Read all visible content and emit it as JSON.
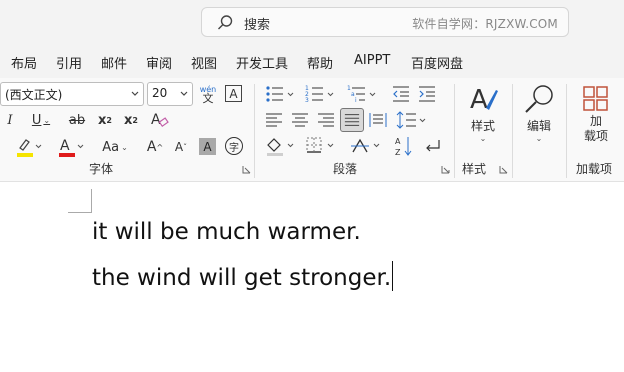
{
  "search": {
    "placeholder": "搜索",
    "watermark": "软件自学网：RJZXW.COM"
  },
  "menu": {
    "items": [
      "布局",
      "引用",
      "邮件",
      "审阅",
      "视图",
      "开发工具",
      "帮助",
      "AIPPT",
      "百度网盘"
    ]
  },
  "ribbon": {
    "font_name": "(西文正文)",
    "font_size": "20",
    "phonetic_top": "wén",
    "phonetic_bottom": "文",
    "char_border": "A",
    "italic": "I",
    "underline": "U",
    "strikethrough": "ab",
    "subscript_base": "x",
    "subscript_sub": "2",
    "superscript_base": "x",
    "superscript_sup": "2",
    "change_case": "Aa",
    "grow_font": "A",
    "shrink_font": "A",
    "shading": "A",
    "enclose_char": "字",
    "group_font": "字体",
    "group_paragraph": "段落",
    "group_styles": "样式",
    "styles_button": "样式",
    "edit_button": "编辑",
    "addin_button_line1": "加",
    "addin_button_line2": "载项",
    "group_addins": "加载项"
  },
  "colors": {
    "highlight": "#f5e400",
    "font_color": "#e01b1b",
    "addin_accent": "#c0533a"
  },
  "document": {
    "lines": [
      "it will be much warmer.",
      "the wind will get stronger."
    ]
  }
}
